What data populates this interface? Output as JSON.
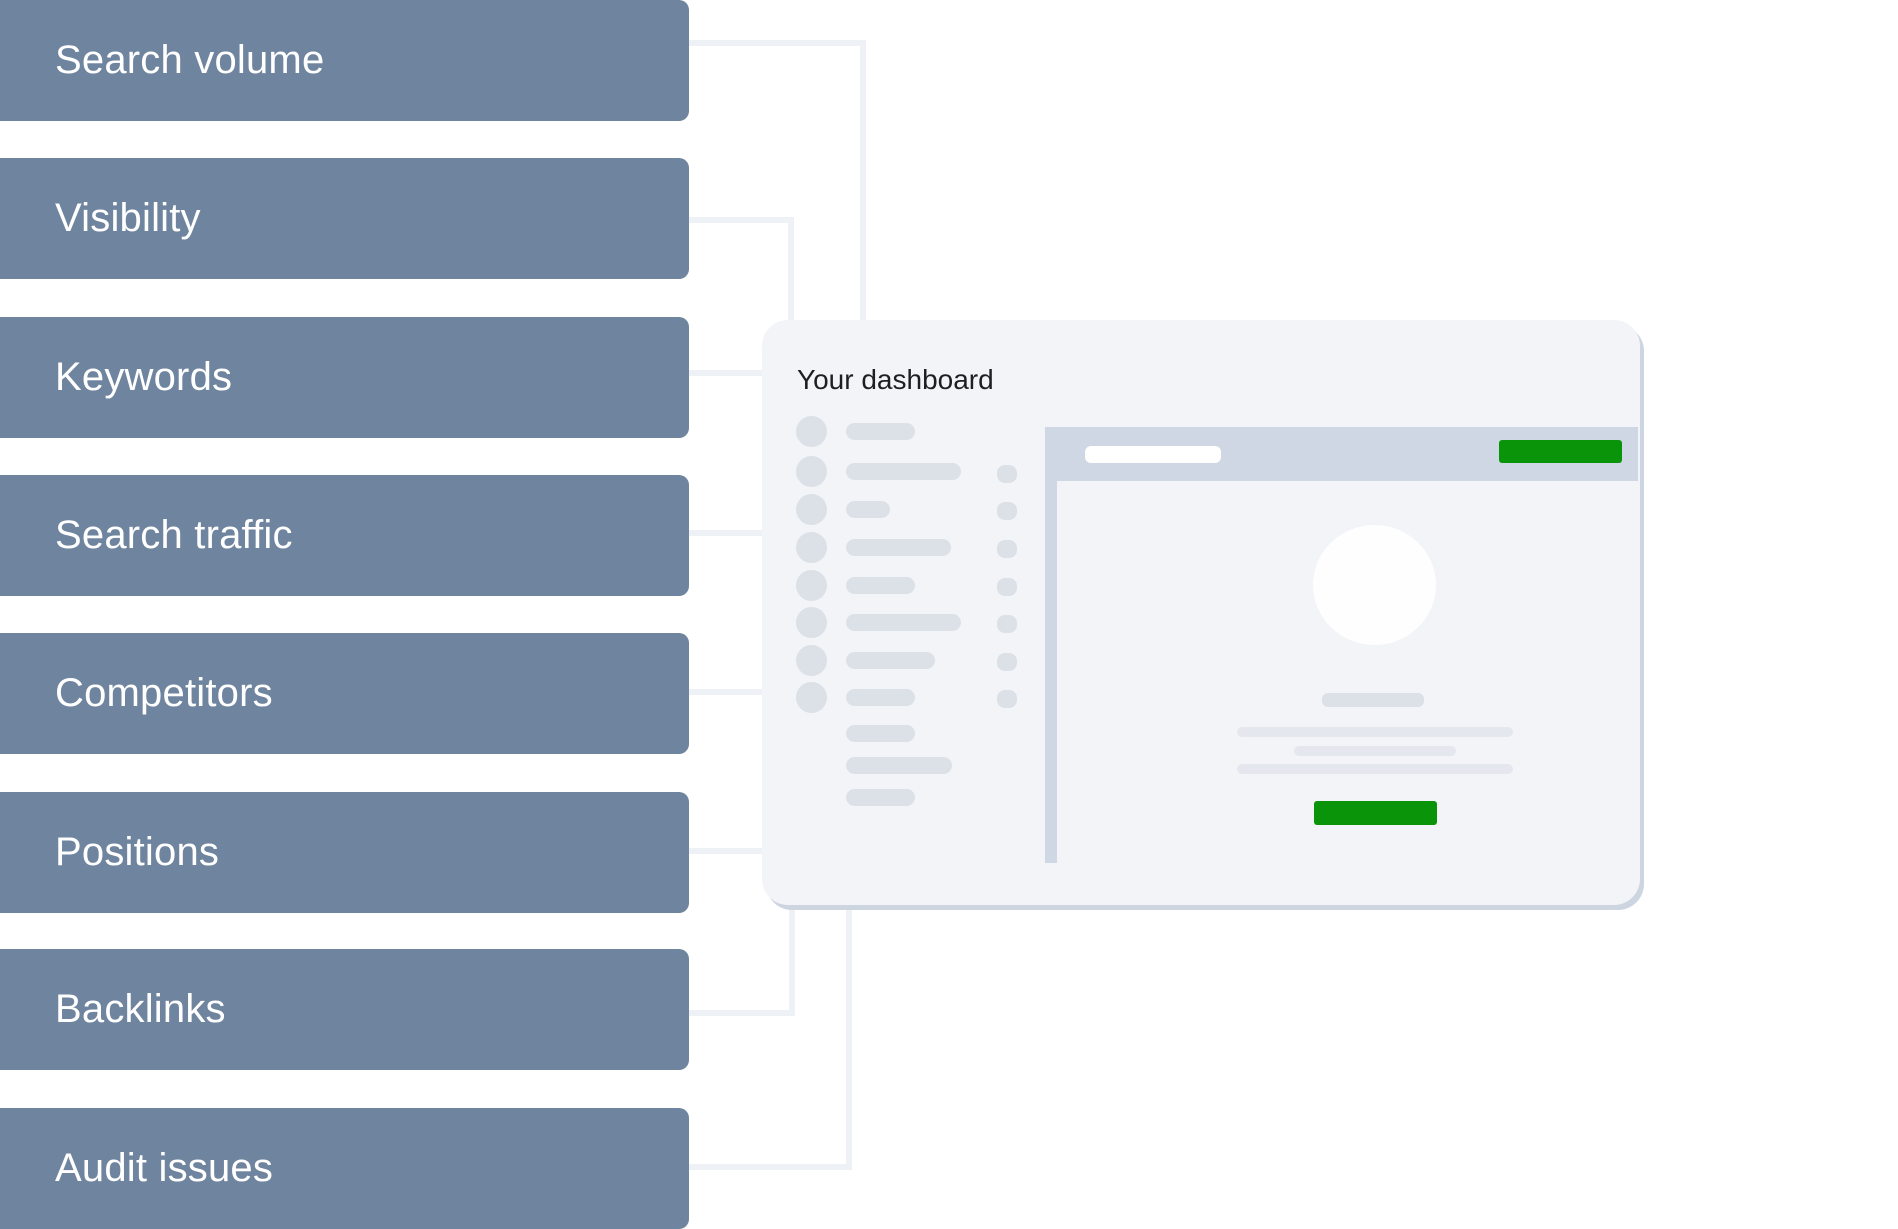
{
  "metrics": [
    {
      "label": "Search volume"
    },
    {
      "label": "Visibility"
    },
    {
      "label": "Keywords"
    },
    {
      "label": "Search traffic"
    },
    {
      "label": "Competitors"
    },
    {
      "label": "Positions"
    },
    {
      "label": "Backlinks"
    },
    {
      "label": "Audit issues"
    }
  ],
  "dashboard": {
    "title": "Your dashboard",
    "list_rows": 8,
    "extra_rows": 3
  },
  "colors": {
    "metric_bg": "#6f849f",
    "metric_text": "#ffffff",
    "card_bg": "#f2f4f8",
    "skeleton": "#dce1e8",
    "toolbar": "#ced7e3",
    "accent_green": "#0a940a",
    "connector": "#eef1f5"
  }
}
